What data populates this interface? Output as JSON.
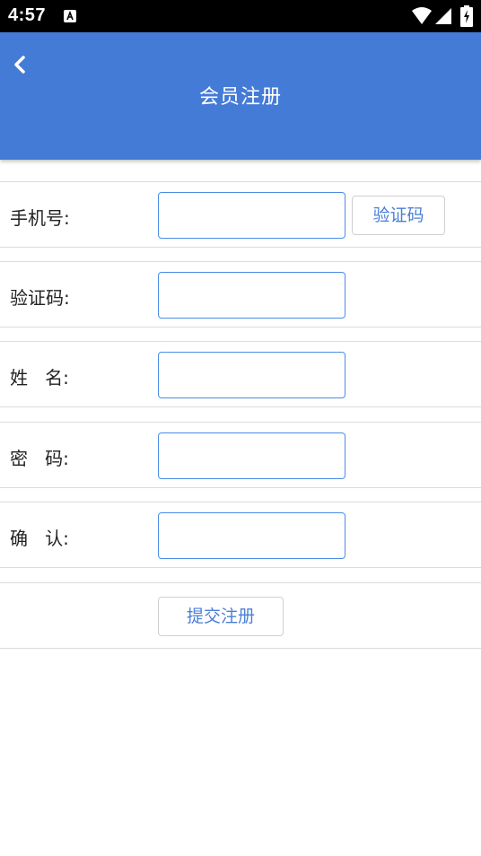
{
  "status_bar": {
    "time": "4:57",
    "notification_icon": "a-icon",
    "icons": [
      "wifi-icon",
      "signal-icon",
      "battery-icon"
    ]
  },
  "header": {
    "title": "会员注册",
    "back_icon": "chevron-left-icon",
    "background_color": "#447bd7"
  },
  "form": {
    "phone": {
      "label": "手机号:",
      "value": "",
      "button_label": "验证码"
    },
    "code": {
      "label": "验证码:",
      "value": ""
    },
    "name": {
      "label": "姓   名:",
      "value": ""
    },
    "password": {
      "label": "密   码:",
      "value": ""
    },
    "confirm": {
      "label": "确   认:",
      "value": ""
    },
    "submit_label": "提交注册"
  },
  "colors": {
    "accent": "#4a7fd6",
    "input_border": "#4a8ce6",
    "divider": "#dcdcdc"
  }
}
